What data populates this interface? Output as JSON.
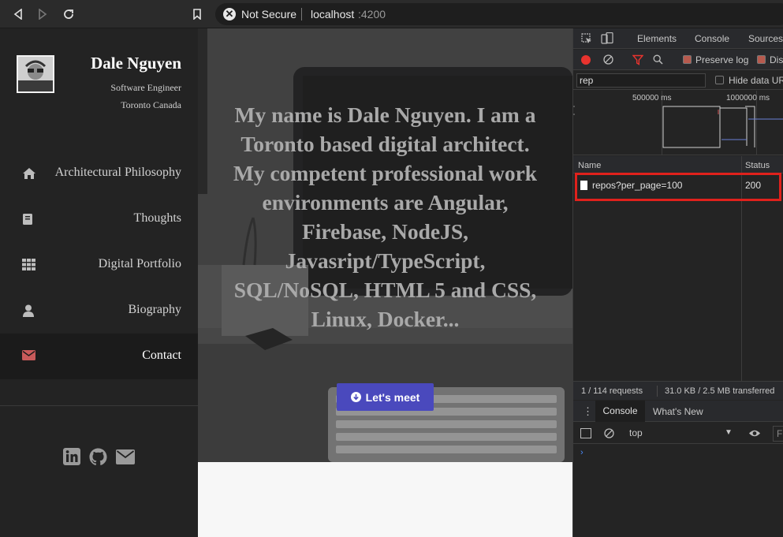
{
  "browser": {
    "security_label": "Not Secure",
    "url_host": "localhost",
    "url_port": ":4200"
  },
  "profile": {
    "name": "Dale Nguyen",
    "role": "Software Engineer",
    "location": "Toronto Canada"
  },
  "nav": {
    "items": [
      {
        "label": "Architectural Philosophy",
        "icon": "home-icon"
      },
      {
        "label": "Thoughts",
        "icon": "book-icon"
      },
      {
        "label": "Digital Portfolio",
        "icon": "grid-icon"
      },
      {
        "label": "Biography",
        "icon": "user-icon"
      },
      {
        "label": "Contact",
        "icon": "envelope-icon",
        "active": true
      }
    ]
  },
  "socials": [
    "linkedin-icon",
    "github-icon",
    "envelope-icon"
  ],
  "hero": {
    "text": "My name is Dale Nguyen. I am a Toronto based digital architect. My competent professional work environments are Angular, Firebase, NodeJS, Javasript/TypeScript, SQL/NoSQL, HTML 5 and CSS, Linux, Docker...",
    "button_label": "Let's meet"
  },
  "devtools": {
    "tabs": [
      "Elements",
      "Console",
      "Sources"
    ],
    "preserve_log_label": "Preserve log",
    "disable_cache_label": "Dis",
    "filter_value": "rep",
    "hide_data_urls_label": "Hide data UR",
    "overview_ticks": [
      "500000 ms",
      "1000000 ms"
    ],
    "columns": {
      "name": "Name",
      "status": "Status"
    },
    "request": {
      "name": "repos?per_page=100",
      "status": "200"
    },
    "summary": {
      "requests": "1 / 114 requests",
      "transferred": "31.0 KB / 2.5 MB transferred"
    },
    "drawer_tabs": [
      "Console",
      "What's New"
    ],
    "console_context": "top",
    "console_filter_placeholder": "Fi",
    "prompt_symbol": "›",
    "accent_red": "#e0211c",
    "record_red": "#e8332e"
  },
  "colors": {
    "sidebar_bg": "#232323",
    "cta_bg": "#4a49bd"
  }
}
